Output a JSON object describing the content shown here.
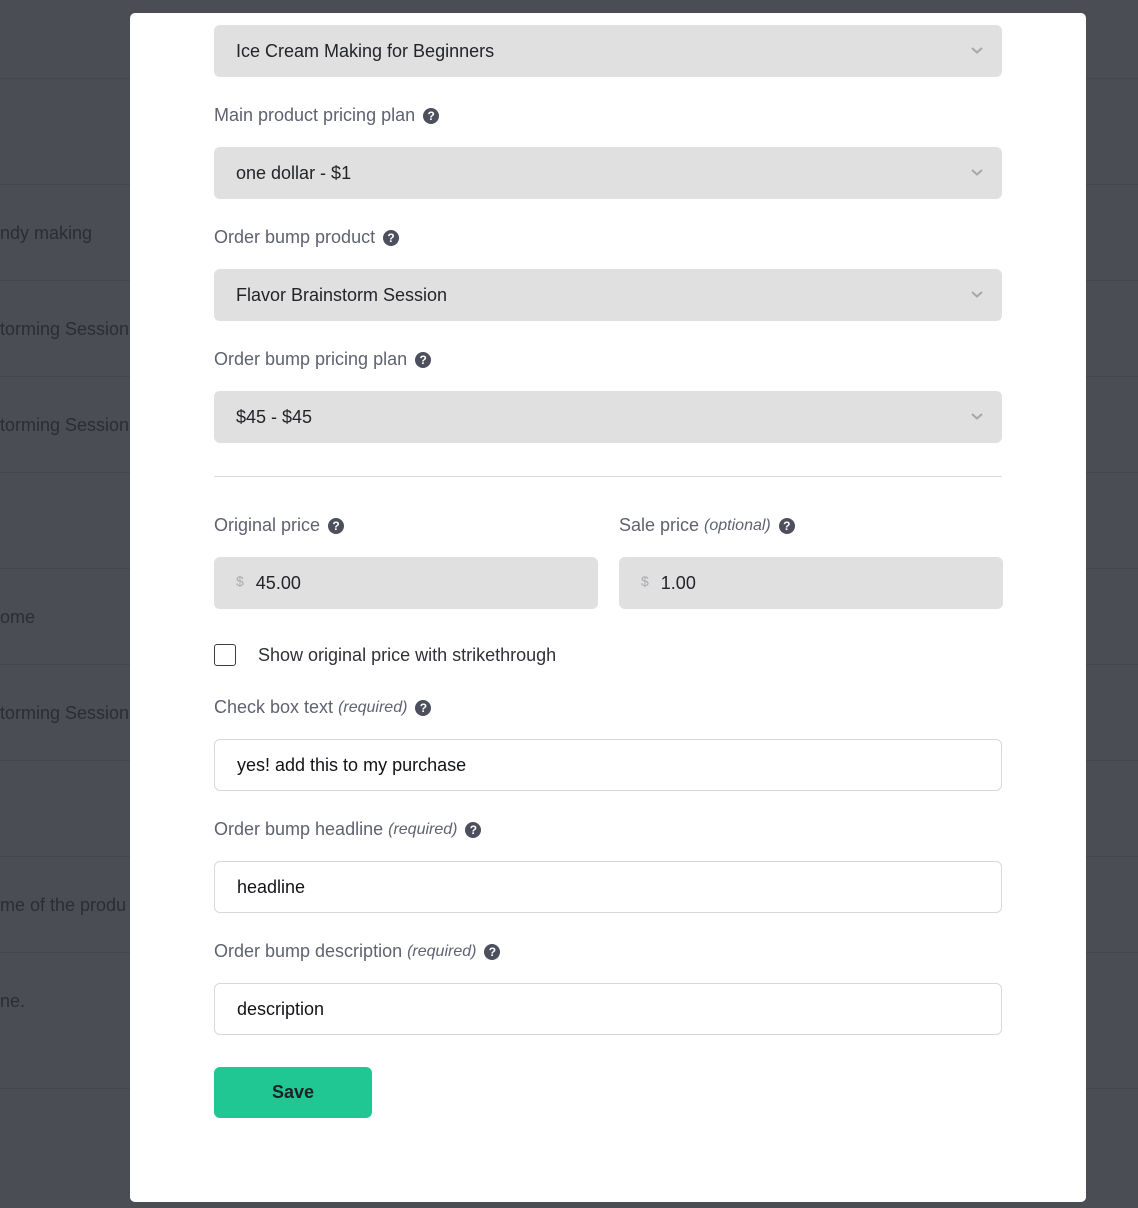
{
  "background_table": {
    "rows": [
      {
        "text": ""
      },
      {
        "text": ""
      },
      {
        "text": "ndy making"
      },
      {
        "text": "torming Session"
      },
      {
        "text": "torming Session"
      },
      {
        "text": ""
      },
      {
        "text": "ome"
      },
      {
        "text": "torming Session"
      },
      {
        "text": ""
      },
      {
        "text": "me of the produ"
      },
      {
        "text": "ne."
      },
      {
        "text": ""
      }
    ]
  },
  "form": {
    "main_product": {
      "value": "Ice Cream Making for Beginners"
    },
    "main_pricing_plan": {
      "label": "Main product pricing plan",
      "value": "one dollar - $1"
    },
    "bump_product": {
      "label": "Order bump product",
      "value": "Flavor Brainstorm Session"
    },
    "bump_pricing_plan": {
      "label": "Order bump pricing plan",
      "value": "$45 - $45"
    },
    "original_price": {
      "label": "Original price",
      "currency": "$",
      "value": "45.00"
    },
    "sale_price": {
      "label": "Sale price",
      "qualifier": "(optional)",
      "currency": "$",
      "value": "1.00"
    },
    "strikethrough": {
      "label": "Show original price with strikethrough",
      "checked": false
    },
    "checkbox_text": {
      "label": "Check box text",
      "qualifier": "(required)",
      "value": "yes! add this to my purchase"
    },
    "headline": {
      "label": "Order bump headline",
      "qualifier": "(required)",
      "value": "headline"
    },
    "description": {
      "label": "Order bump description",
      "qualifier": "(required)",
      "value": "description"
    },
    "save_label": "Save",
    "help_glyph": "?"
  },
  "colors": {
    "accent": "#20c793",
    "overlay": "#4a4e54",
    "field_bg": "#e0e0e0"
  }
}
